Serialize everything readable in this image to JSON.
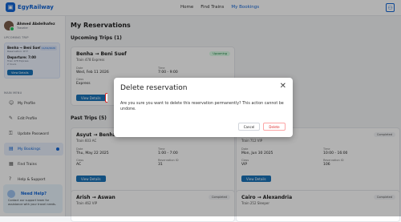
{
  "brand": {
    "name": "EgyRailway",
    "logo_icon": "train-icon"
  },
  "nav": {
    "home": "Home",
    "find_trains": "Find Trains",
    "my_bookings": "My Bookings",
    "active": "My Bookings"
  },
  "user": {
    "name": "Ahmed Abdelhafez",
    "subtitle": "Traveler"
  },
  "sidebar": {
    "upcoming_title": "UPCOMING TRIP",
    "upcoming": {
      "route": "Benha → Beni Suef",
      "reservation": "Reservation: #77",
      "date": "11/02/2026",
      "departure": "Departure: 7:00",
      "train": "Train 478 Express",
      "duration": "2 hours",
      "button": "View Details"
    },
    "menu_title": "MAIN MENU",
    "items": [
      {
        "label": "My Profile",
        "icon": "user-icon"
      },
      {
        "label": "Edit Profile",
        "icon": "edit-icon"
      },
      {
        "label": "Update Password",
        "icon": "lock-icon"
      },
      {
        "label": "My Bookings",
        "icon": "ticket-icon"
      },
      {
        "label": "Find Trains",
        "icon": "train-icon"
      },
      {
        "label": "Help & Support",
        "icon": "help-icon"
      }
    ],
    "help": {
      "title": "Need Help?",
      "text": "Contact our support team for assistance with your travel needs."
    }
  },
  "main": {
    "title": "My Reservations",
    "upcoming_heading": "Upcoming Trips (1)",
    "past_heading": "Past Trips (5)",
    "labels": {
      "date": "Date",
      "time": "Time",
      "class": "Class",
      "reservation_id": "Reservation ID"
    },
    "upcoming_trip": {
      "route": "Benha → Beni Suef",
      "train": "Train 478 Express",
      "badge": "Upcoming",
      "date": "Wed, Feb 11 2026",
      "time": "7:00 - 9:00",
      "class": "Express",
      "button": "View Details"
    },
    "past_trips": [
      {
        "route": "Asyut → Benha",
        "train": "Train 603 AC",
        "badge": "Completed",
        "date": "Thu, May 22 2025",
        "time": "1:00 - 7:00",
        "class": "AC",
        "reservation_id": "31",
        "button": "View Details"
      },
      {
        "route": "",
        "train": "Train 712 VIP",
        "badge": "Completed",
        "date": "Mon, Jun 30 2025",
        "time": "10:00 - 16:00",
        "class": "VIP",
        "reservation_id": "106",
        "button": "View Details"
      },
      {
        "route": "Arish → Aswan",
        "train": "Train 462 VIP",
        "badge": "Completed"
      },
      {
        "route": "Cairo → Alexandria",
        "train": "Train 252 Sleeper",
        "badge": "Completed"
      }
    ]
  },
  "modal": {
    "title": "Delete reservation",
    "body": "Are you sure you want to delete this reservation permanently? This action cannot be undone.",
    "cancel": "Cancel",
    "delete": "Delete"
  },
  "colors": {
    "accent": "#1366d6",
    "button": "#1a73b8",
    "danger": "#dc2626",
    "upcoming_badge": "#15803d"
  }
}
